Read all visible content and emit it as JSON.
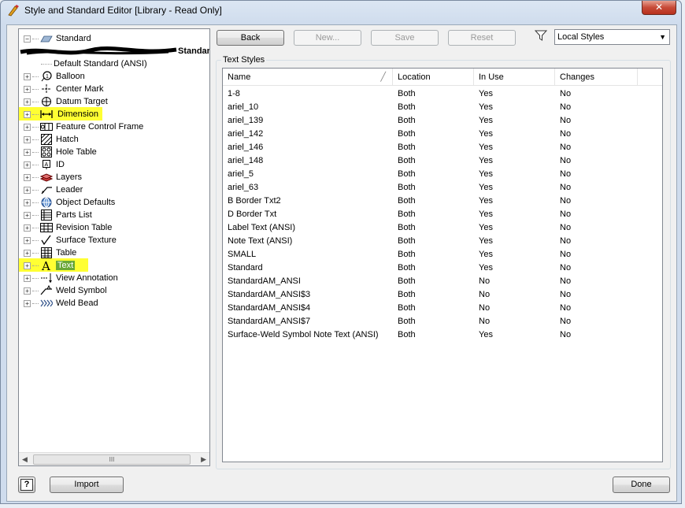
{
  "window": {
    "title": "Style and Standard Editor [Library - Read Only]",
    "close_label": "✕"
  },
  "tree": {
    "root": "Standard",
    "redacted_item": "Standard (A",
    "default_item": "Default Standard (ANSI)",
    "items": [
      {
        "label": "Balloon",
        "icon": "balloon-icon"
      },
      {
        "label": "Center Mark",
        "icon": "center-mark-icon"
      },
      {
        "label": "Datum Target",
        "icon": "datum-target-icon"
      },
      {
        "label": "Dimension",
        "icon": "dimension-icon",
        "highlight": "yellow"
      },
      {
        "label": "Feature Control Frame",
        "icon": "feature-control-frame-icon"
      },
      {
        "label": "Hatch",
        "icon": "hatch-icon"
      },
      {
        "label": "Hole Table",
        "icon": "hole-table-icon"
      },
      {
        "label": "ID",
        "icon": "id-icon"
      },
      {
        "label": "Layers",
        "icon": "layers-icon"
      },
      {
        "label": "Leader",
        "icon": "leader-icon"
      },
      {
        "label": "Object Defaults",
        "icon": "object-defaults-icon"
      },
      {
        "label": "Parts List",
        "icon": "parts-list-icon"
      },
      {
        "label": "Revision Table",
        "icon": "revision-table-icon"
      },
      {
        "label": "Surface Texture",
        "icon": "surface-texture-icon"
      },
      {
        "label": "Table",
        "icon": "table-icon"
      },
      {
        "label": "Text",
        "icon": "text-icon",
        "highlight": "green"
      },
      {
        "label": "View Annotation",
        "icon": "view-annotation-icon"
      },
      {
        "label": "Weld Symbol",
        "icon": "weld-symbol-icon"
      },
      {
        "label": "Weld Bead",
        "icon": "weld-bead-icon"
      }
    ],
    "scroll_thumb": "III"
  },
  "toolbar": {
    "back": "Back",
    "new": "New...",
    "save": "Save",
    "reset": "Reset",
    "filter_value": "Local Styles",
    "filter_icon": "filter-icon"
  },
  "text_styles": {
    "group_title": "Text Styles",
    "columns": [
      "Name",
      "Location",
      "In Use",
      "Changes"
    ],
    "rows": [
      [
        "1-8",
        "Both",
        "Yes",
        "No"
      ],
      [
        "ariel_10",
        "Both",
        "Yes",
        "No"
      ],
      [
        "ariel_139",
        "Both",
        "Yes",
        "No"
      ],
      [
        "ariel_142",
        "Both",
        "Yes",
        "No"
      ],
      [
        "ariel_146",
        "Both",
        "Yes",
        "No"
      ],
      [
        "ariel_148",
        "Both",
        "Yes",
        "No"
      ],
      [
        "ariel_5",
        "Both",
        "Yes",
        "No"
      ],
      [
        "ariel_63",
        "Both",
        "Yes",
        "No"
      ],
      [
        "B Border Txt2",
        "Both",
        "Yes",
        "No"
      ],
      [
        "D Border Txt",
        "Both",
        "Yes",
        "No"
      ],
      [
        "Label Text (ANSI)",
        "Both",
        "Yes",
        "No"
      ],
      [
        "Note Text (ANSI)",
        "Both",
        "Yes",
        "No"
      ],
      [
        "SMALL",
        "Both",
        "Yes",
        "No"
      ],
      [
        "Standard",
        "Both",
        "Yes",
        "No"
      ],
      [
        "StandardAM_ANSI",
        "Both",
        "No",
        "No"
      ],
      [
        "StandardAM_ANSI$3",
        "Both",
        "No",
        "No"
      ],
      [
        "StandardAM_ANSI$4",
        "Both",
        "No",
        "No"
      ],
      [
        "StandardAM_ANSI$7",
        "Both",
        "No",
        "No"
      ],
      [
        "Surface-Weld Symbol Note Text (ANSI)",
        "Both",
        "Yes",
        "No"
      ]
    ]
  },
  "footer": {
    "help": "?",
    "import": "Import",
    "done": "Done"
  }
}
